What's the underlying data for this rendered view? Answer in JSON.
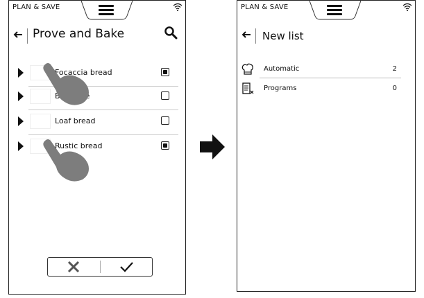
{
  "left": {
    "brand": "PLAN & SAVE",
    "title": "Prove and Bake",
    "items": [
      {
        "label": "Focaccia bread",
        "checked": true
      },
      {
        "label": "Baguette",
        "checked": false
      },
      {
        "label": "Loaf bread",
        "checked": false
      },
      {
        "label": "Rustic bread",
        "checked": true
      }
    ],
    "buttons": {
      "cancel": "✕",
      "confirm": "✓"
    }
  },
  "right": {
    "brand": "PLAN & SAVE",
    "title": "New list",
    "lists": [
      {
        "label": "Automatic",
        "count": "2",
        "icon": "chef-hat-icon"
      },
      {
        "label": "Programs",
        "count": "0",
        "icon": "program-icon"
      }
    ]
  },
  "transition_icon": "right-arrow-icon"
}
